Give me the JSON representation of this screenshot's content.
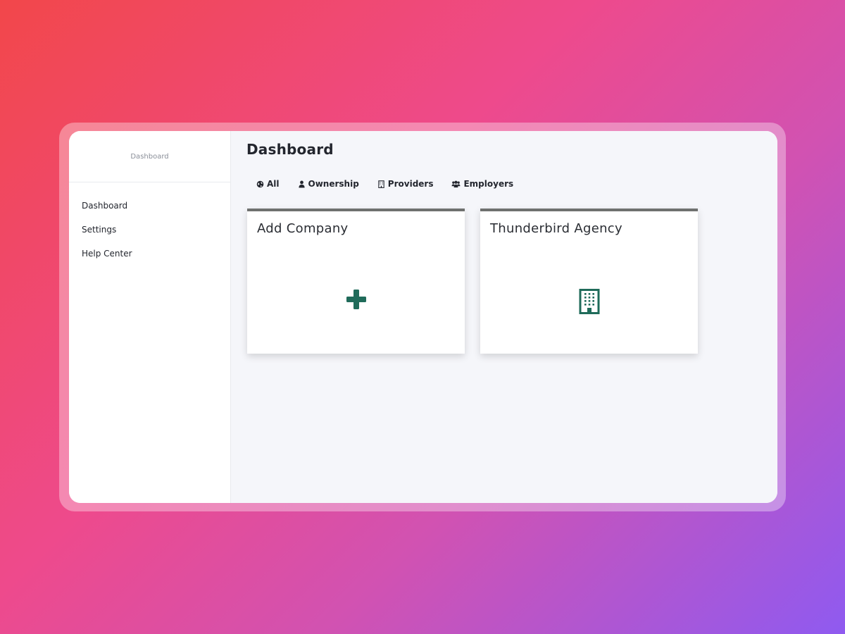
{
  "sidebar": {
    "header": "Dashboard",
    "items": [
      {
        "label": "Dashboard"
      },
      {
        "label": "Settings"
      },
      {
        "label": "Help Center"
      }
    ]
  },
  "main": {
    "title": "Dashboard",
    "tabs": [
      {
        "label": "All",
        "icon": "globe-icon"
      },
      {
        "label": "Ownership",
        "icon": "user-icon"
      },
      {
        "label": "Providers",
        "icon": "building-icon"
      },
      {
        "label": "Employers",
        "icon": "users-icon"
      }
    ],
    "cards": [
      {
        "title": "Add Company",
        "icon": "plus-icon"
      },
      {
        "title": "Thunderbird Agency",
        "icon": "building-icon"
      }
    ]
  },
  "colors": {
    "accent": "#1f6b5a",
    "card_border": "#6f716f",
    "text": "#23262e",
    "main_bg": "#f5f6fa"
  }
}
